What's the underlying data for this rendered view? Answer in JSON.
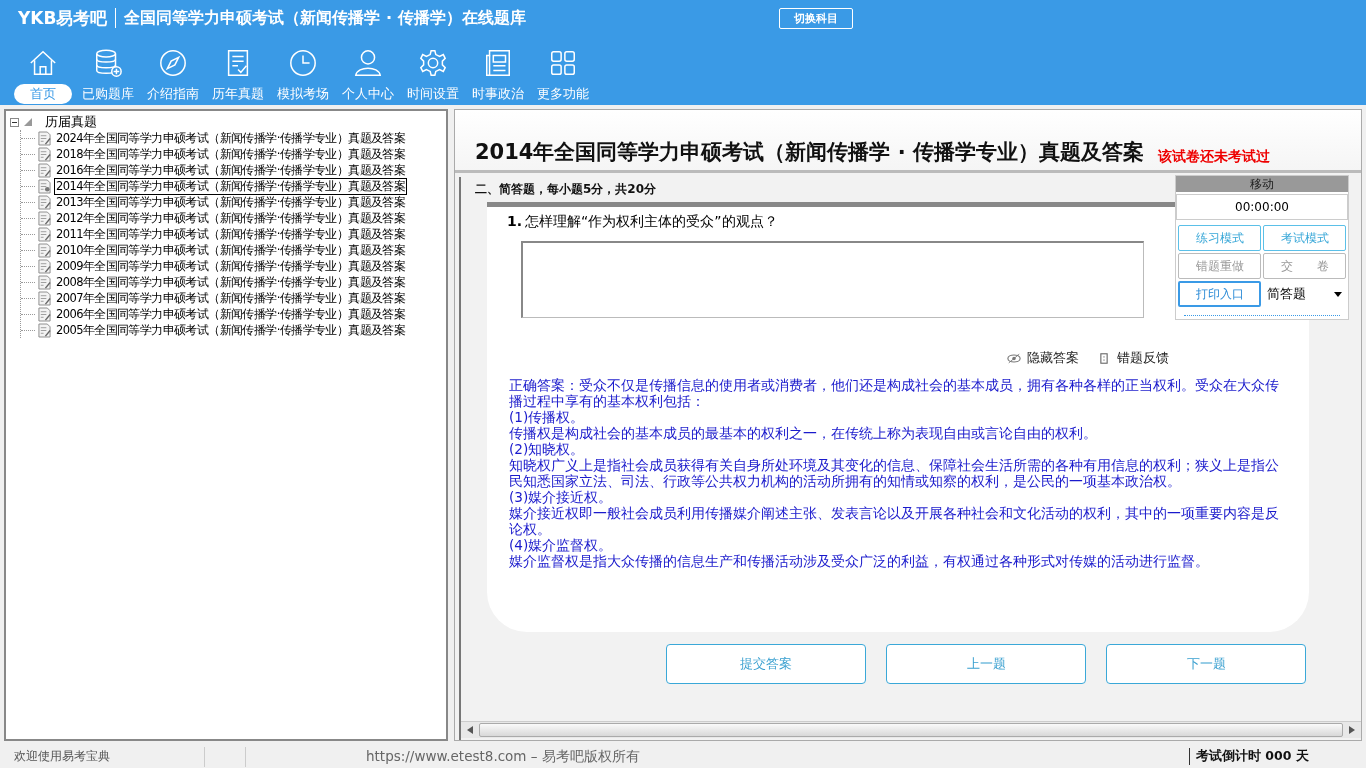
{
  "header": {
    "logo": "YKB易考吧",
    "title": "全国同等学力申硕考试（新闻传播学 · 传播学）在线题库",
    "switch_button": "切换科目"
  },
  "toolbar": [
    {
      "label": "首页",
      "selected": true
    },
    {
      "label": "已购题库",
      "selected": false
    },
    {
      "label": "介绍指南",
      "selected": false
    },
    {
      "label": "历年真题",
      "selected": false
    },
    {
      "label": "模拟考场",
      "selected": false
    },
    {
      "label": "个人中心",
      "selected": false
    },
    {
      "label": "时间设置",
      "selected": false
    },
    {
      "label": "时事政治",
      "selected": false
    },
    {
      "label": "更多功能",
      "selected": false
    }
  ],
  "tree": {
    "label": "历届真题",
    "expanded": true,
    "children": [
      {
        "label": "2024年全国同等学力申硕考试（新闻传播学·传播学专业）真题及答案",
        "selected": false
      },
      {
        "label": "2018年全国同等学力申硕考试（新闻传播学·传播学专业）真题及答案",
        "selected": false
      },
      {
        "label": "2016年全国同等学力申硕考试（新闻传播学·传播学专业）真题及答案",
        "selected": false
      },
      {
        "label": "2014年全国同等学力申硕考试（新闻传播学·传播学专业）真题及答案",
        "selected": true
      },
      {
        "label": "2013年全国同等学力申硕考试（新闻传播学·传播学专业）真题及答案",
        "selected": false
      },
      {
        "label": "2012年全国同等学力申硕考试（新闻传播学·传播学专业）真题及答案",
        "selected": false
      },
      {
        "label": "2011年全国同等学力申硕考试（新闻传播学·传播学专业）真题及答案",
        "selected": false
      },
      {
        "label": "2010年全国同等学力申硕考试（新闻传播学·传播学专业）真题及答案",
        "selected": false
      },
      {
        "label": "2009年全国同等学力申硕考试（新闻传播学·传播学专业）真题及答案",
        "selected": false
      },
      {
        "label": "2008年全国同等学力申硕考试（新闻传播学·传播学专业）真题及答案",
        "selected": false
      },
      {
        "label": "2007年全国同等学力申硕考试（新闻传播学·传播学专业）真题及答案",
        "selected": false
      },
      {
        "label": "2006年全国同等学力申硕考试（新闻传播学·传播学专业）真题及答案",
        "selected": false
      },
      {
        "label": "2005年全国同等学力申硕考试（新闻传播学·传播学专业）真题及答案",
        "selected": false
      }
    ]
  },
  "exam": {
    "title": "2014年全国同等学力申硕考试（新闻传播学 · 传播学专业）真题及答案",
    "status": "该试卷还未考试过",
    "section": "二、简答题，每小题5分，共20分",
    "question": {
      "number": "1.",
      "text": "怎样理解“作为权利主体的受众”的观点？"
    },
    "links": [
      "隐藏答案",
      "错题反馈"
    ],
    "answer": [
      "正确答案：受众不仅是传播信息的使用者或消费者，他们还是构成社会的基本成员，拥有各种各样的正当权利。受众在大众传播过程中享有的基本权利包括：",
      "(1)传播权。",
      "传播权是构成社会的基本成员的最基本的权利之一，在传统上称为表现自由或言论自由的权利。",
      "(2)知晓权。",
      "知晓权广义上是指社会成员获得有关自身所处环境及其变化的信息、保障社会生活所需的各种有用信息的权利；狭义上是指公民知悉国家立法、司法、行政等公共权力机构的活动所拥有的知情或知察的权利，是公民的一项基本政治权。",
      "(3)媒介接近权。",
      "媒介接近权即一般社会成员利用传播媒介阐述主张、发表言论以及开展各种社会和文化活动的权利，其中的一项重要内容是反论权。",
      "(4)媒介监督权。",
      "媒介监督权是指大众传播的信息生产和传播活动涉及受众广泛的利益，有权通过各种形式对传媒的活动进行监督。"
    ],
    "nav_buttons": [
      "提交答案",
      "上一题",
      "下一题"
    ]
  },
  "panel": {
    "header": "移动",
    "timer": "00:00:00",
    "buttons": [
      {
        "label": "练习模式",
        "disabled": false
      },
      {
        "label": "考试模式",
        "disabled": false
      },
      {
        "label": "错题重做",
        "disabled": true
      },
      {
        "label": "交　　卷",
        "disabled": true
      },
      {
        "label": "打印入口",
        "disabled": false
      }
    ],
    "dropdown": "简答题"
  },
  "status_bar": {
    "welcome": "欢迎使用易考宝典",
    "copyright": "https://www.etest8.com – 易考吧版权所有",
    "countdown": "考试倒计时 000 天"
  }
}
